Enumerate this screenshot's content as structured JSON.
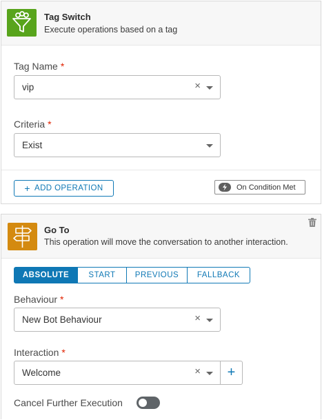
{
  "tag_switch": {
    "icon": "tag-filter-icon",
    "icon_color": "#58a41c",
    "title": "Tag Switch",
    "subtitle": "Execute operations based on a tag",
    "tag_name": {
      "label": "Tag Name",
      "required_mark": "*",
      "value": "vip"
    },
    "criteria": {
      "label": "Criteria",
      "required_mark": "*",
      "value": "Exist"
    },
    "add_operation_label": "ADD OPERATION",
    "condition_chip_label": "On Condition Met"
  },
  "go_to": {
    "icon": "signpost-icon",
    "icon_color": "#d48a10",
    "title": "Go To",
    "subtitle": "This operation will move the conversation to another interaction.",
    "tabs": [
      {
        "label": "ABSOLUTE",
        "active": true
      },
      {
        "label": "START",
        "active": false
      },
      {
        "label": "PREVIOUS",
        "active": false
      },
      {
        "label": "FALLBACK",
        "active": false
      }
    ],
    "behaviour": {
      "label": "Behaviour",
      "required_mark": "*",
      "value": "New Bot Behaviour"
    },
    "interaction": {
      "label": "Interaction",
      "required_mark": "*",
      "value": "Welcome"
    },
    "cancel_execution": {
      "label": "Cancel Further Execution",
      "enabled": false
    }
  },
  "colors": {
    "accent": "#0f78b5",
    "required": "#e12200"
  },
  "symbols": {
    "clear": "×",
    "plus": "+"
  }
}
